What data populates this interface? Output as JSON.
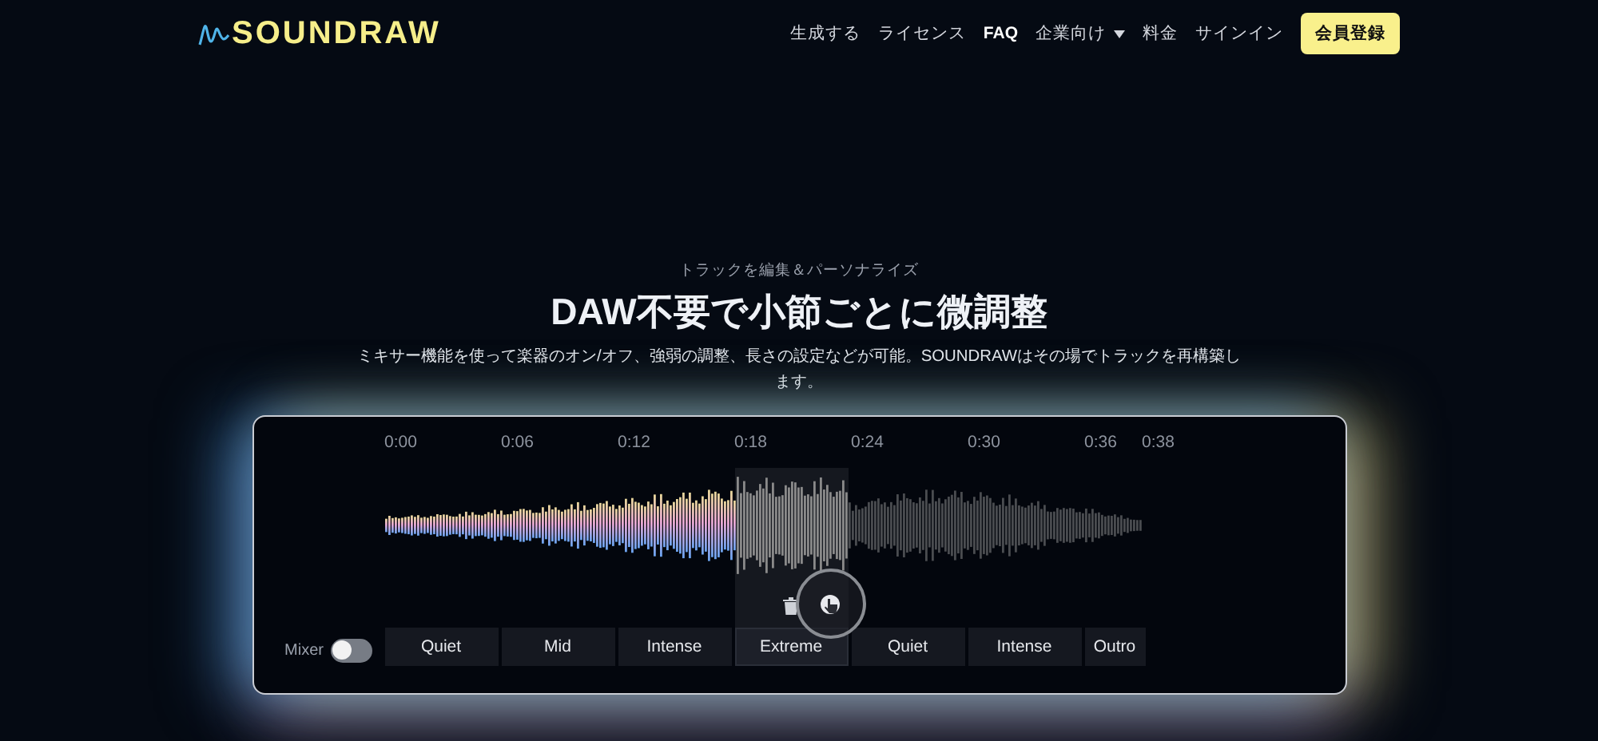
{
  "logo": {
    "text": "SOUNDRAW"
  },
  "nav": {
    "items": [
      {
        "label": "生成する",
        "bold": false,
        "dropdown": false
      },
      {
        "label": "ライセンス",
        "bold": false,
        "dropdown": false
      },
      {
        "label": "FAQ",
        "bold": true,
        "dropdown": false
      },
      {
        "label": "企業向け",
        "bold": false,
        "dropdown": true
      },
      {
        "label": "料金",
        "bold": false,
        "dropdown": false
      },
      {
        "label": "サインイン",
        "bold": false,
        "dropdown": false
      }
    ],
    "cta": "会員登録"
  },
  "hero": {
    "eyebrow": "トラックを編集＆パーソナライズ",
    "title": "DAW不要で小節ごとに微調整",
    "description": "ミキサー機能を使って楽器のオン/オフ、強弱の調整、長さの設定などが可能。SOUNDRAWはその場でトラックを再構築します。"
  },
  "editor": {
    "timeline": [
      "0:00",
      "0:06",
      "0:12",
      "0:18",
      "0:24",
      "0:30",
      "0:36",
      "0:38"
    ],
    "mixer": {
      "label": "Mixer",
      "on": false
    },
    "sections": [
      {
        "label": "Quiet",
        "selected": false
      },
      {
        "label": "Mid",
        "selected": false
      },
      {
        "label": "Intense",
        "selected": false
      },
      {
        "label": "Extreme",
        "selected": true
      },
      {
        "label": "Quiet",
        "selected": false
      },
      {
        "label": "Intense",
        "selected": false
      },
      {
        "label": "Outro",
        "selected": false
      }
    ]
  }
}
